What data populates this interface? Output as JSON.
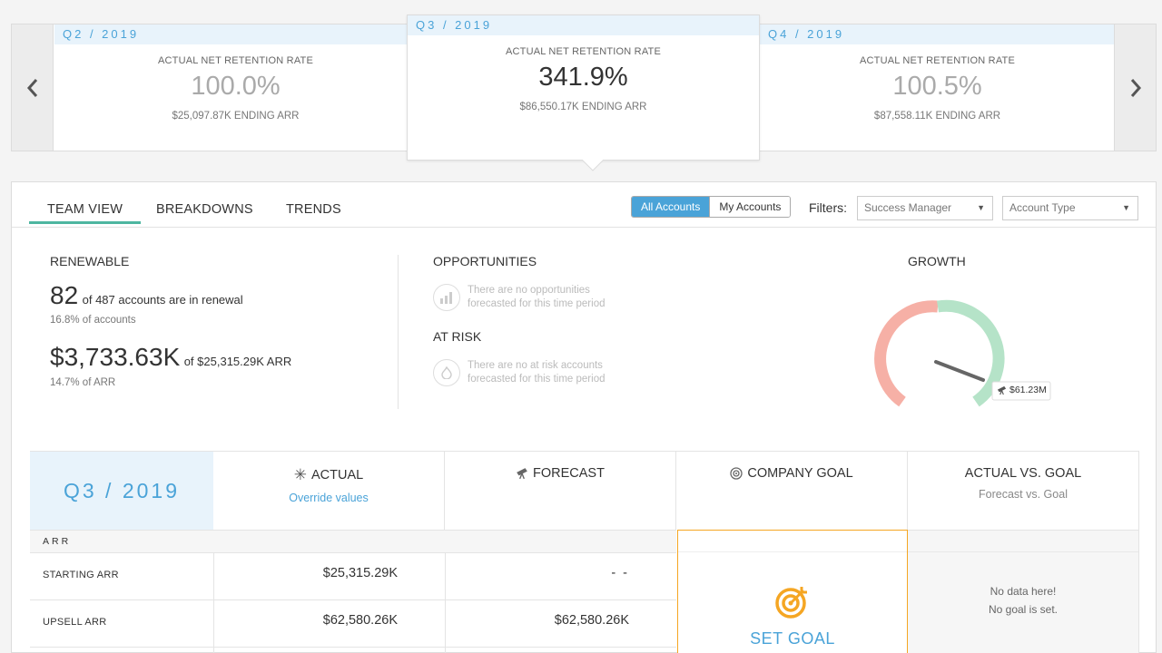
{
  "carousel": {
    "prev_icon": "chevron-left-icon",
    "next_icon": "chevron-right-icon",
    "cards": [
      {
        "quarter": "Q2 / 2019",
        "rate_label": "ACTUAL NET RETENTION RATE",
        "rate_value": "100.0%",
        "ending_arr": "$25,097.87K ENDING ARR"
      },
      {
        "quarter": "Q3 / 2019",
        "rate_label": "ACTUAL NET RETENTION RATE",
        "rate_value": "341.9%",
        "ending_arr": "$86,550.17K ENDING ARR"
      },
      {
        "quarter": "Q4 / 2019",
        "rate_label": "ACTUAL NET RETENTION RATE",
        "rate_value": "100.5%",
        "ending_arr": "$87,558.11K ENDING ARR"
      }
    ]
  },
  "tabs": [
    {
      "label": "TEAM VIEW",
      "active": true
    },
    {
      "label": "BREAKDOWNS",
      "active": false
    },
    {
      "label": "TRENDS",
      "active": false
    }
  ],
  "account_toggle": {
    "all": "All Accounts",
    "mine": "My Accounts",
    "selected": "all"
  },
  "filters": {
    "label": "Filters:",
    "success_manager_placeholder": "Success Manager",
    "account_type_placeholder": "Account Type"
  },
  "renewable": {
    "title": "RENEWABLE",
    "count": "82",
    "count_text": "of 487 accounts are in renewal",
    "count_pct": "16.8% of accounts",
    "arr": "$3,733.63K",
    "arr_text": "of $25,315.29K ARR",
    "arr_pct": "14.7% of ARR"
  },
  "opportunities": {
    "title": "OPPORTUNITIES",
    "empty": "There are no opportunities forecasted for this time period",
    "icon": "bar-chart-icon"
  },
  "at_risk": {
    "title": "AT RISK",
    "empty": "There are no at risk accounts forecasted for this time period",
    "icon": "flame-icon"
  },
  "growth": {
    "title": "GROWTH",
    "value_label": "$61.23M",
    "value_icon": "telescope-icon",
    "colors": {
      "negative": "#f6b0a6",
      "positive": "#b5e3c8",
      "needle": "#666666"
    }
  },
  "table": {
    "quarter": "Q3 / 2019",
    "columns": {
      "actual": {
        "label": "ACTUAL",
        "sub": "Override values",
        "icon": "asterisk-icon"
      },
      "forecast": {
        "label": "FORECAST",
        "icon": "telescope-icon"
      },
      "goal": {
        "label": "COMPANY GOAL",
        "icon": "target-icon"
      },
      "vs": {
        "label": "ACTUAL VS. GOAL",
        "sub": "Forecast vs. Goal"
      }
    },
    "section": "ARR",
    "rows": [
      {
        "label": "STARTING ARR",
        "actual": "$25,315.29K",
        "forecast": "- -"
      },
      {
        "label": "UPSELL ARR",
        "actual": "$62,580.26K",
        "forecast": "$62,580.26K"
      }
    ],
    "set_goal": "SET GOAL",
    "no_data_line1": "No data here!",
    "no_data_line2": "No goal is set."
  },
  "colors": {
    "accent_blue": "#4aa3d8",
    "tab_underline": "#4db6a0",
    "goal_orange": "#f5a623"
  }
}
